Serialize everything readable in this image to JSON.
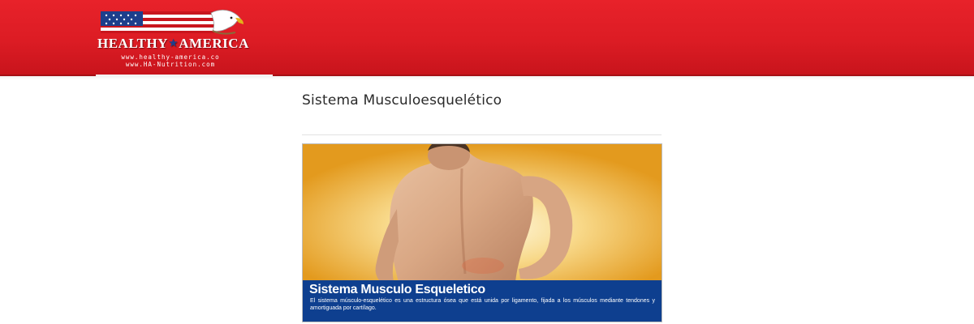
{
  "brand": {
    "name_left": "HEALTHY",
    "name_right": "AMERICA",
    "url_primary": "www.healthy-america.co",
    "url_secondary": "www.HA-Nutrition.com"
  },
  "colors": {
    "header_red": "#e0232b",
    "caption_blue": "#0e3f8f",
    "banner_orange": "#e8a52a"
  },
  "page": {
    "title": "Sistema Musculoesquelético"
  },
  "banner": {
    "caption_title": "Sistema Musculo Esqueletico",
    "caption_text": "El sistema músculo-esquelético es una estructura ósea que está unida por ligamento, fijada a los músculos mediante tendones y amortiguada por cartílago."
  }
}
